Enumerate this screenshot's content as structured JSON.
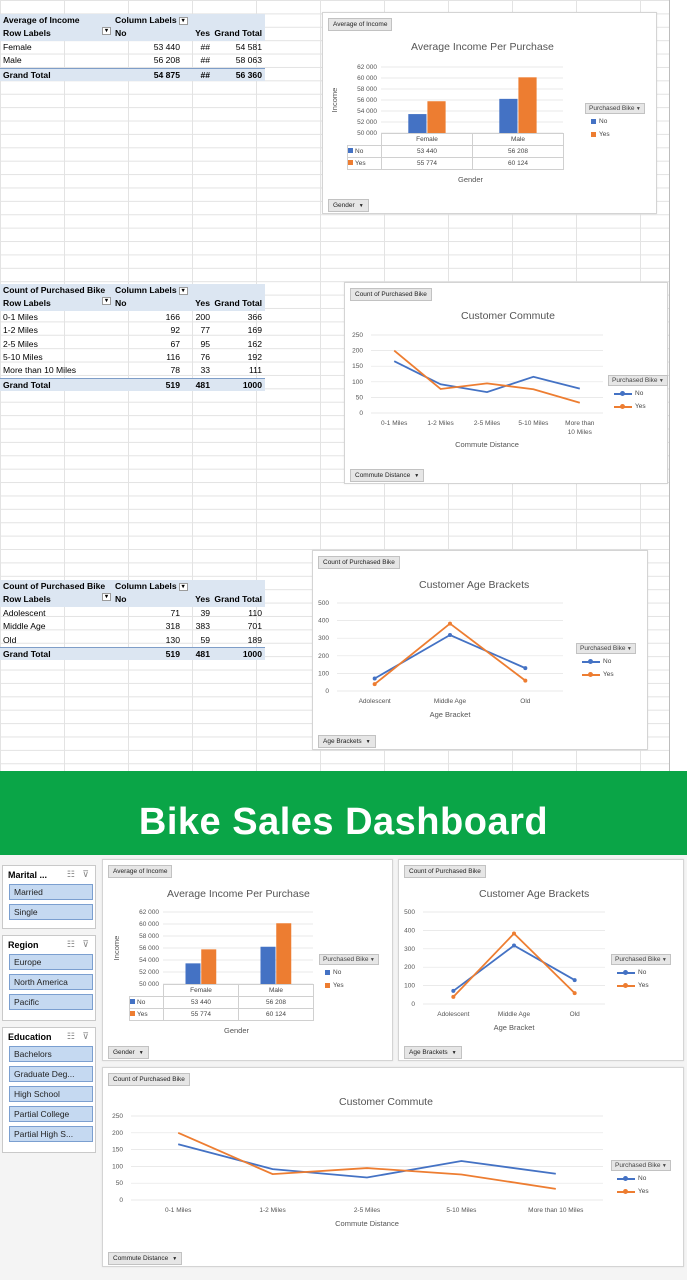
{
  "pivot_income": {
    "header1": [
      "Average of Income",
      "Column Labels"
    ],
    "header2": [
      "Row Labels",
      "No",
      "Yes",
      "Grand Total"
    ],
    "rows": [
      {
        "label": "Female",
        "no": "53 440",
        "yes": "##",
        "gt": "54 581"
      },
      {
        "label": "Male",
        "no": "56 208",
        "yes": "##",
        "gt": "58 063"
      }
    ],
    "total": {
      "label": "Grand Total",
      "no": "54 875",
      "yes": "##",
      "gt": "56 360"
    }
  },
  "pivot_commute": {
    "header1": [
      "Count of Purchased Bike",
      "Column Labels"
    ],
    "header2": [
      "Row Labels",
      "No",
      "Yes",
      "Grand Total"
    ],
    "rows": [
      {
        "label": "0-1 Miles",
        "no": "166",
        "yes": "200",
        "gt": "366"
      },
      {
        "label": "1-2 Miles",
        "no": "92",
        "yes": "77",
        "gt": "169"
      },
      {
        "label": "2-5 Miles",
        "no": "67",
        "yes": "95",
        "gt": "162"
      },
      {
        "label": "5-10 Miles",
        "no": "116",
        "yes": "76",
        "gt": "192"
      },
      {
        "label": "More than 10 Miles",
        "no": "78",
        "yes": "33",
        "gt": "111"
      }
    ],
    "total": {
      "label": "Grand Total",
      "no": "519",
      "yes": "481",
      "gt": "1000"
    }
  },
  "pivot_age": {
    "header1": [
      "Count of Purchased Bike",
      "Column Labels"
    ],
    "header2": [
      "Row Labels",
      "No",
      "Yes",
      "Grand Total"
    ],
    "rows": [
      {
        "label": "Adolescent",
        "no": "71",
        "yes": "39",
        "gt": "110"
      },
      {
        "label": "Middle Age",
        "no": "318",
        "yes": "383",
        "gt": "701"
      },
      {
        "label": "Old",
        "no": "130",
        "yes": "59",
        "gt": "189"
      }
    ],
    "total": {
      "label": "Grand Total",
      "no": "519",
      "yes": "481",
      "gt": "1000"
    }
  },
  "colors": {
    "no": "#4472c4",
    "yes": "#ed7d31",
    "banner": "#0aa547"
  },
  "chart_data": [
    {
      "type": "bar",
      "field_label": "Average of Income",
      "title": "Average Income Per Purchase",
      "categories": [
        "Female",
        "Male"
      ],
      "series": [
        {
          "name": "No",
          "values": [
            53440,
            56208
          ],
          "labels": [
            "53 440",
            "56 208"
          ]
        },
        {
          "name": "Yes",
          "values": [
            55774,
            60124
          ],
          "labels": [
            "55 774",
            "60 124"
          ]
        }
      ],
      "xlabel": "Gender",
      "ylabel": "Income",
      "ylim": [
        50000,
        62000
      ],
      "yticks": [
        "62 000",
        "60 000",
        "58 000",
        "56 000",
        "54 000",
        "52 000",
        "50 000"
      ],
      "legend_title": "Purchased Bike",
      "axis_button": "Gender",
      "legend": "right",
      "grid": true
    },
    {
      "type": "line",
      "field_label": "Count of Purchased Bike",
      "title": "Customer Commute",
      "categories": [
        "0-1 Miles",
        "1-2 Miles",
        "2-5 Miles",
        "5-10 Miles",
        "More than 10 Miles"
      ],
      "series": [
        {
          "name": "No",
          "values": [
            166,
            92,
            67,
            116,
            78
          ]
        },
        {
          "name": "Yes",
          "values": [
            200,
            77,
            95,
            76,
            33
          ]
        }
      ],
      "xlabel": "Commute Distance",
      "ylim": [
        0,
        250
      ],
      "yticks": [
        "250",
        "200",
        "150",
        "100",
        "50",
        "0"
      ],
      "legend_title": "Purchased Bike",
      "axis_button": "Commute Distance",
      "legend": "right",
      "grid": true
    },
    {
      "type": "line",
      "field_label": "Count of Purchased Bike",
      "title": "Customer Age Brackets",
      "categories": [
        "Adolescent",
        "Middle Age",
        "Old"
      ],
      "series": [
        {
          "name": "No",
          "values": [
            71,
            318,
            130
          ]
        },
        {
          "name": "Yes",
          "values": [
            39,
            383,
            59
          ]
        }
      ],
      "xlabel": "Age Bracket",
      "ylim": [
        0,
        500
      ],
      "yticks": [
        "500",
        "400",
        "300",
        "200",
        "100",
        "0"
      ],
      "legend_title": "Purchased Bike",
      "axis_button": "Age Brackets",
      "legend": "right",
      "grid": true
    }
  ],
  "dashboard": {
    "title": "Bike Sales Dashboard",
    "slicers": [
      {
        "title": "Marital ...",
        "items": [
          "Married",
          "Single"
        ]
      },
      {
        "title": "Region",
        "items": [
          "Europe",
          "North America",
          "Pacific"
        ]
      },
      {
        "title": "Education",
        "items": [
          "Bachelors",
          "Graduate Deg...",
          "High School",
          "Partial College",
          "Partial High S..."
        ]
      }
    ],
    "commute_short_label": "More than 10 Miles"
  }
}
